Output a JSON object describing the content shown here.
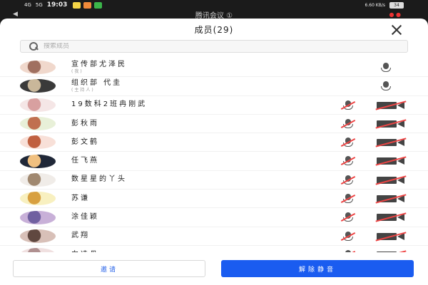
{
  "status": {
    "signal1": "4G",
    "signal2": "5G",
    "time": "19:03",
    "speed": "6.60 KB/s",
    "battery": "34"
  },
  "behind": {
    "title": "腾讯会议 ①"
  },
  "panel": {
    "title": "成员(29)",
    "search_placeholder": "搜索成员"
  },
  "members": [
    {
      "name": "宣传部尤泽民",
      "sub": "(我)",
      "mic": "muted-small",
      "cam": "none"
    },
    {
      "name": "组织部  代圭",
      "sub": "(主持人)",
      "mic": "muted-small",
      "cam": "none"
    },
    {
      "name": "19数科2班冉刚武",
      "sub": "",
      "mic": "muted",
      "cam": "off"
    },
    {
      "name": "彭秋雨",
      "sub": "",
      "mic": "muted",
      "cam": "off"
    },
    {
      "name": "彭文鹤",
      "sub": "",
      "mic": "muted",
      "cam": "off"
    },
    {
      "name": "任飞燕",
      "sub": "",
      "mic": "muted",
      "cam": "off"
    },
    {
      "name": "数星星的丫头",
      "sub": "",
      "mic": "muted",
      "cam": "off"
    },
    {
      "name": "苏谦",
      "sub": "",
      "mic": "muted",
      "cam": "off"
    },
    {
      "name": "涂佳颖",
      "sub": "",
      "mic": "muted",
      "cam": "off"
    },
    {
      "name": "武翔",
      "sub": "",
      "mic": "muted",
      "cam": "off"
    },
    {
      "name": "向凌丹",
      "sub": "",
      "mic": "muted",
      "cam": "off"
    }
  ],
  "footer": {
    "invite_label": "邀请",
    "unmute_all_label": "解除静音"
  },
  "colors": {
    "accent": "#1a5cf0",
    "muted_slash": "#e44444"
  }
}
